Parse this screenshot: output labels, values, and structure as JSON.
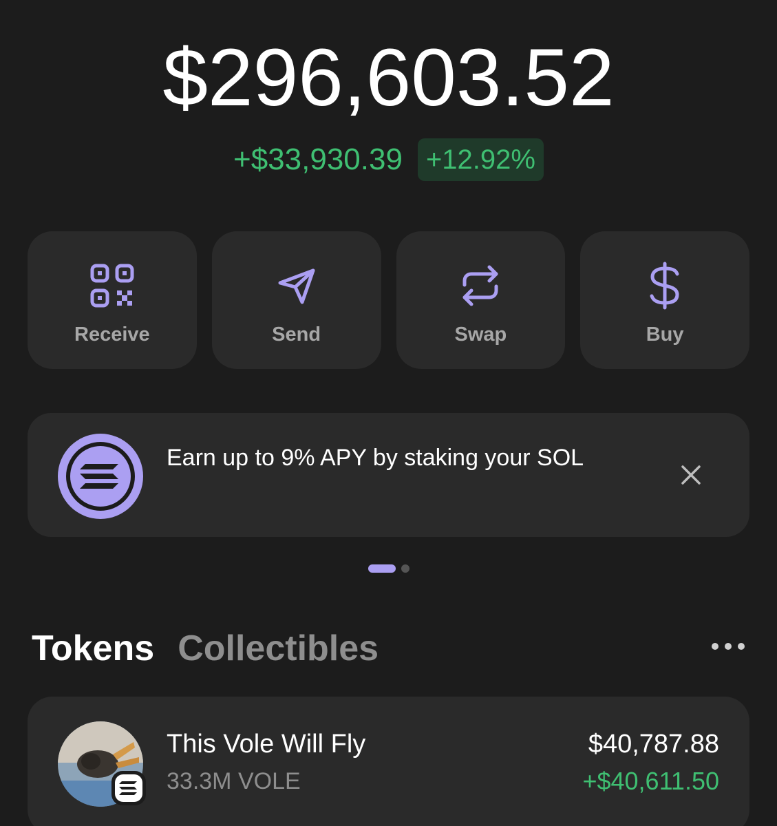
{
  "balance": {
    "total": "$296,603.52",
    "change_amount": "+$33,930.39",
    "change_percent": "+12.92%"
  },
  "actions": [
    {
      "label": "Receive",
      "icon": "qr-code-icon"
    },
    {
      "label": "Send",
      "icon": "send-icon"
    },
    {
      "label": "Swap",
      "icon": "swap-icon"
    },
    {
      "label": "Buy",
      "icon": "dollar-icon"
    }
  ],
  "promo": {
    "text": "Earn up to 9% APY by staking your SOL",
    "icon": "solana-icon",
    "close_icon": "close-icon"
  },
  "carousel": {
    "page_count": 2,
    "active_index": 0
  },
  "tabs": {
    "tokens": "Tokens",
    "collectibles": "Collectibles",
    "more_icon": "more-icon"
  },
  "tokens": [
    {
      "name": "This Vole Will Fly",
      "amount": "33.3M VOLE",
      "value": "$40,787.88",
      "change": "+$40,611.50"
    }
  ],
  "colors": {
    "background": "#1c1c1c",
    "card": "#2a2a2a",
    "accent": "#ab9ff2",
    "positive": "#3fbf72",
    "positive_bg": "#1f3a2a",
    "muted": "#8e8e8e"
  }
}
